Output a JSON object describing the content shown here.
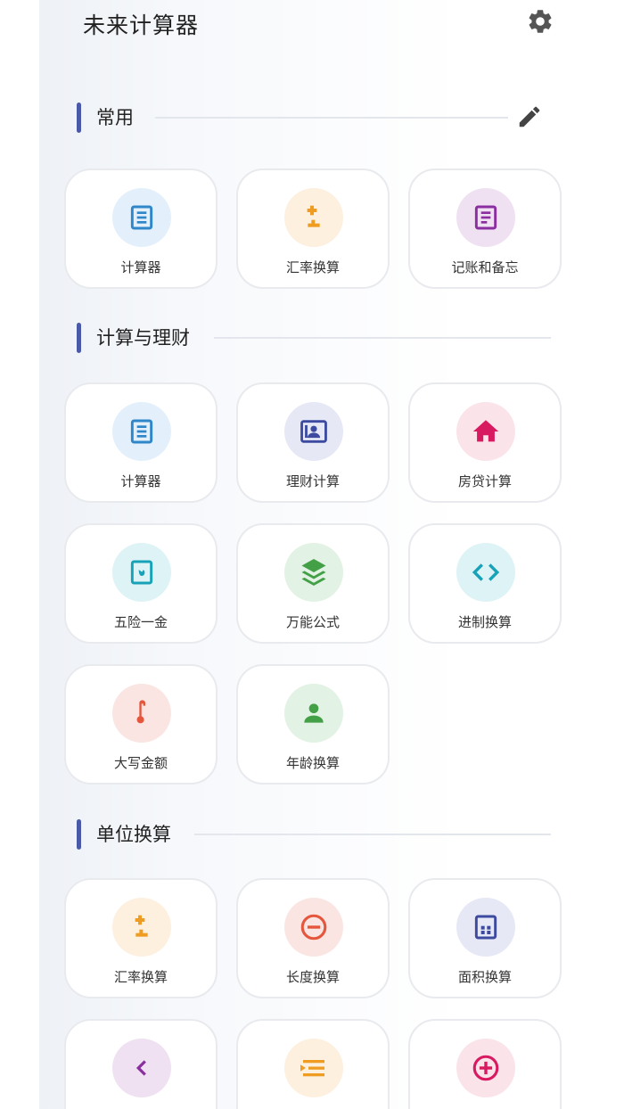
{
  "app": {
    "title": "未来计算器"
  },
  "sections": [
    {
      "title": "常用",
      "items": [
        {
          "label": "计算器",
          "icon": "calculator-icon",
          "bg": "#e3f0fb",
          "color": "#2f86c9"
        },
        {
          "label": "汇率换算",
          "icon": "plus-minus-icon",
          "bg": "#fdf0df",
          "color": "#ef9d22"
        },
        {
          "label": "记账和备忘",
          "icon": "notes-icon",
          "bg": "#efe1f2",
          "color": "#8b2fa0"
        }
      ]
    },
    {
      "title": "计算与理财",
      "items": [
        {
          "label": "计算器",
          "icon": "calculator-icon",
          "bg": "#e3f0fb",
          "color": "#2f86c9"
        },
        {
          "label": "理财计算",
          "icon": "portrait-icon",
          "bg": "#e6e8f5",
          "color": "#3c4aa0"
        },
        {
          "label": "房贷计算",
          "icon": "home-icon",
          "bg": "#fbe3ea",
          "color": "#d81b60"
        },
        {
          "label": "五险一金",
          "icon": "insurance-icon",
          "bg": "#def3f6",
          "color": "#17a2b8"
        },
        {
          "label": "万能公式",
          "icon": "layers-icon",
          "bg": "#e2f2e4",
          "color": "#43a047"
        },
        {
          "label": "进制换算",
          "icon": "code-icon",
          "bg": "#def3f6",
          "color": "#17a2b8"
        },
        {
          "label": "大写金额",
          "icon": "thermometer-icon",
          "bg": "#fbe5e3",
          "color": "#e4573d"
        },
        {
          "label": "年龄换算",
          "icon": "person-icon",
          "bg": "#e2f2e4",
          "color": "#43a047"
        }
      ]
    },
    {
      "title": "单位换算",
      "items": [
        {
          "label": "汇率换算",
          "icon": "plus-minus-icon",
          "bg": "#fdf0df",
          "color": "#ef9d22"
        },
        {
          "label": "长度换算",
          "icon": "minus-circle-icon",
          "bg": "#fbe5e3",
          "color": "#e4573d"
        },
        {
          "label": "面积换算",
          "icon": "area-icon",
          "bg": "#e6e8f5",
          "color": "#3c4aa0"
        },
        {
          "label": "",
          "icon": "chevron-left-icon",
          "bg": "#efe1f2",
          "color": "#8b2fa0"
        },
        {
          "label": "",
          "icon": "list-icon",
          "bg": "#fdf0df",
          "color": "#ef9d22"
        },
        {
          "label": "",
          "icon": "plus-circle-icon",
          "bg": "#fbe3ea",
          "color": "#d81b60"
        }
      ]
    }
  ],
  "icons": {
    "settings": "gear-icon",
    "edit": "pencil-icon"
  }
}
